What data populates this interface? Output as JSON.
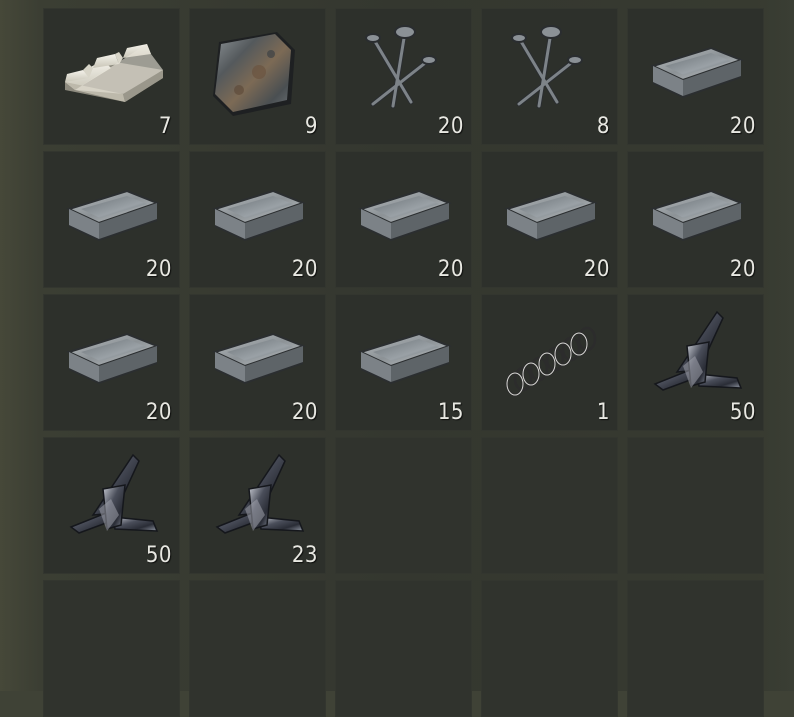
{
  "inventory": {
    "slots": [
      {
        "item": "hq-metal-bars-icon",
        "quantity": "7"
      },
      {
        "item": "metal-sheet-icon",
        "quantity": "9"
      },
      {
        "item": "nails-icon",
        "quantity": "20"
      },
      {
        "item": "nails-icon",
        "quantity": "8"
      },
      {
        "item": "metal-ingot-icon",
        "quantity": "20"
      },
      {
        "item": "metal-ingot-icon",
        "quantity": "20"
      },
      {
        "item": "metal-ingot-icon",
        "quantity": "20"
      },
      {
        "item": "metal-ingot-icon",
        "quantity": "20"
      },
      {
        "item": "metal-ingot-icon",
        "quantity": "20"
      },
      {
        "item": "metal-ingot-icon",
        "quantity": "20"
      },
      {
        "item": "metal-ingot-icon",
        "quantity": "20"
      },
      {
        "item": "metal-ingot-icon",
        "quantity": "20"
      },
      {
        "item": "metal-ingot-icon",
        "quantity": "15"
      },
      {
        "item": "metal-spring-icon",
        "quantity": "1"
      },
      {
        "item": "metal-fragments-icon",
        "quantity": "50"
      },
      {
        "item": "metal-fragments-icon",
        "quantity": "50"
      },
      {
        "item": "metal-fragments-icon",
        "quantity": "23"
      },
      {
        "item": null,
        "quantity": null
      },
      {
        "item": null,
        "quantity": null
      },
      {
        "item": null,
        "quantity": null
      },
      {
        "item": null,
        "quantity": null
      },
      {
        "item": null,
        "quantity": null
      },
      {
        "item": null,
        "quantity": null
      },
      {
        "item": null,
        "quantity": null
      },
      {
        "item": null,
        "quantity": null
      }
    ]
  }
}
